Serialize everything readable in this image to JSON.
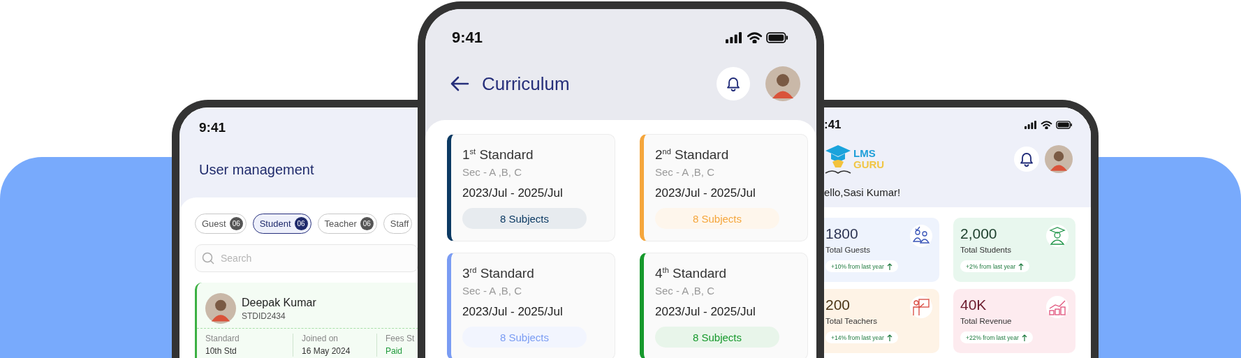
{
  "user_management_screen": {
    "status_time": "9:41",
    "title": "User management",
    "filter_chips": [
      {
        "label": "Guest",
        "count": "06",
        "selected": false
      },
      {
        "label": "Student",
        "count": "06",
        "selected": true
      },
      {
        "label": "Teacher",
        "count": "06",
        "selected": false
      },
      {
        "label": "Staff",
        "selected": false
      }
    ],
    "search": {
      "placeholder": "Search"
    },
    "student_card": {
      "name": "Deepak Kumar",
      "id": "STDID2434",
      "fields": [
        {
          "label": "Standard",
          "value": "10th Std",
          "kind": "text"
        },
        {
          "label": "Joined on",
          "value": "16 May 2024",
          "kind": "text"
        },
        {
          "label": "Fees St",
          "value": "Paid",
          "kind": "status"
        }
      ]
    }
  },
  "curriculum_screen": {
    "status_time": "9:41",
    "title": "Curriculum",
    "standards": [
      {
        "title": "1$^{st}$ Standard",
        "sections": "Sec - A ,B, C",
        "period": "2023/Jul - 2025/Jul",
        "subjects": "8 Subjects",
        "color": "#0c3a63"
      },
      {
        "title": "2$^{nd}$ Standard",
        "sections": "Sec - A ,B, C",
        "period": "2023/Jul - 2025/Jul",
        "subjects": "8 Subjects",
        "color": "#f5a63c"
      },
      {
        "title": "3$^{rd}$ Standard",
        "sections": "Sec - A ,B, C",
        "period": "2023/Jul - 2025/Jul",
        "subjects": "8 Subjects",
        "color": "#7a9cf3"
      },
      {
        "title": "4$^{th}$ Standard",
        "sections": "Sec - A ,B, C",
        "period": "2023/Jul - 2025/Jul",
        "subjects": "8 Subjects",
        "color": "#16992c"
      }
    ]
  },
  "dashboard_screen": {
    "status_time": ":41",
    "logo": {
      "line_1": "LMS",
      "line_2": "GURU"
    },
    "greeting": "ello,Sasi Kumar!",
    "stats": [
      {
        "value": "1800",
        "label": "Total Guests",
        "change": "+10% from last year",
        "color": "#eef3fd"
      },
      {
        "value": "2,000",
        "label": "Total Students",
        "change": "+2% from last year",
        "color": "#e8f7ee"
      },
      {
        "value": "200",
        "label": "Total Teachers",
        "change": "+14% from last year",
        "color": "#fef3e6"
      },
      {
        "value": "40K",
        "label": "Total Revenue",
        "change": "+22% from last year",
        "color": "#fdebef"
      }
    ]
  }
}
